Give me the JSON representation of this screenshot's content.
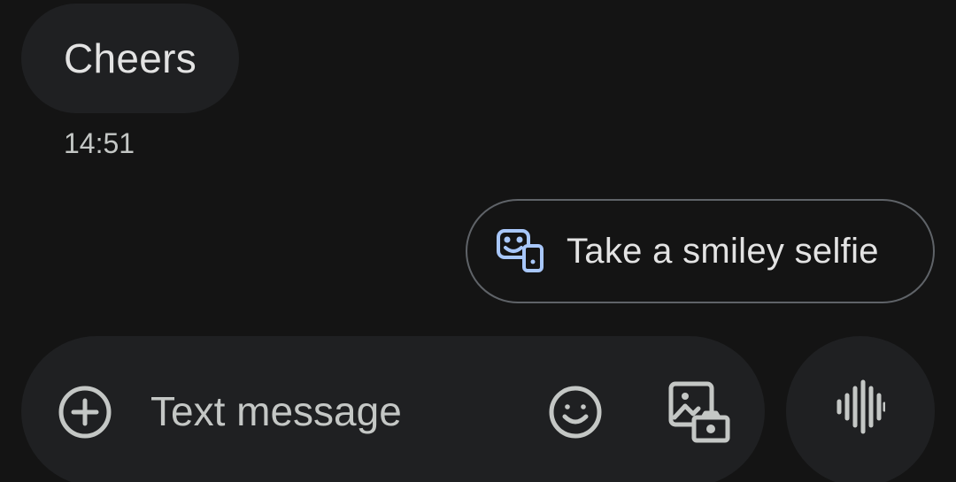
{
  "conversation": {
    "incoming_message": {
      "text": "Cheers",
      "timestamp": "14:51"
    }
  },
  "suggestion": {
    "label": "Take a smiley selfie",
    "icon": "smiley-selfie-icon",
    "accent_color": "#a8c7fa"
  },
  "compose": {
    "placeholder": "Text message",
    "value": "",
    "icons": {
      "attach": "add-circle-icon",
      "emoji": "emoji-icon",
      "gallery": "gallery-camera-icon",
      "voice": "voice-waveform-icon"
    }
  },
  "colors": {
    "background": "#141414",
    "surface": "#1f2022",
    "text": "#e3e3e3",
    "outline": "#5f6368"
  }
}
